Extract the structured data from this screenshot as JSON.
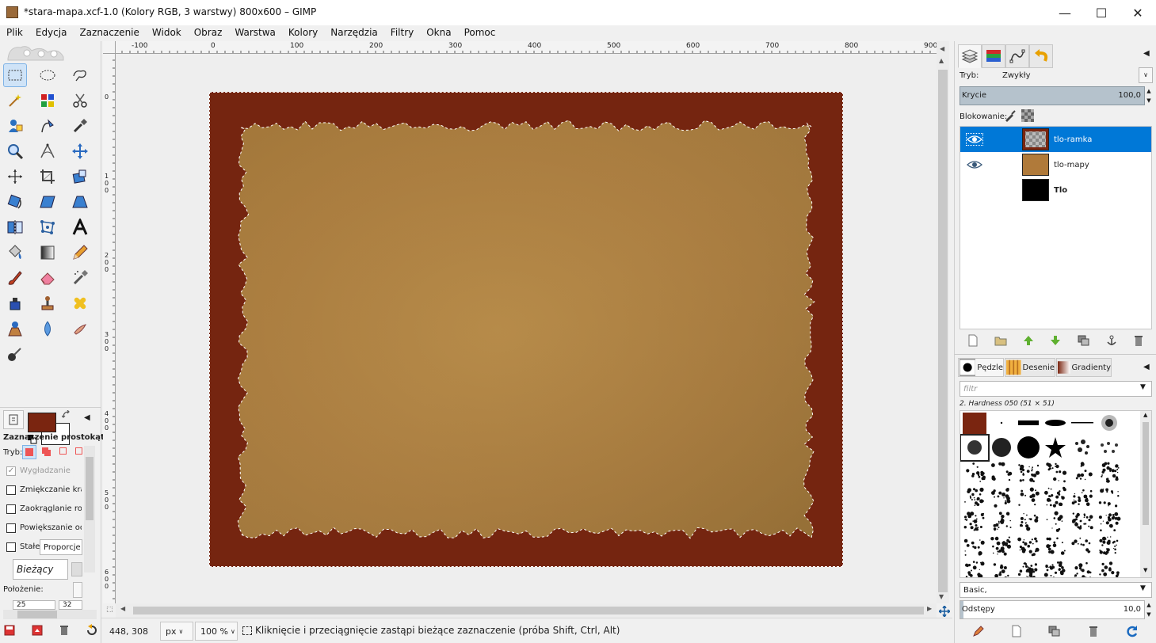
{
  "window": {
    "title": "*stara-mapa.xcf-1.0 (Kolory RGB, 3 warstwy) 800x600 – GIMP",
    "minimize": "—",
    "maximize": "☐",
    "close": "✕"
  },
  "menu": [
    "Plik",
    "Edycja",
    "Zaznaczenie",
    "Widok",
    "Obraz",
    "Warstwa",
    "Kolory",
    "Narzędzia",
    "Filtry",
    "Okna",
    "Pomoc"
  ],
  "toolbox": {
    "tools": [
      "rect-select",
      "ellipse-select",
      "free-select",
      "fuzzy-select",
      "select-by-color",
      "scissors-select",
      "foreground-select",
      "paths",
      "color-picker",
      "zoom",
      "measure",
      "move",
      "align",
      "crop",
      "unified-transform",
      "rotate",
      "shear",
      "perspective",
      "flip",
      "cage-transform",
      "text",
      "bucket-fill",
      "blend",
      "pencil",
      "paintbrush",
      "eraser",
      "airbrush",
      "ink",
      "clone",
      "heal",
      "perspective-clone",
      "blur",
      "smudge",
      "dodge-burn"
    ],
    "fg_color": "#7a2510",
    "bg_color": "#ffffff"
  },
  "tool_options": {
    "title": "Zaznaczenie prostokątne",
    "mode_label": "Tryb:",
    "antialias": "Wygładzanie",
    "feather": "Zmiękczanie kraw",
    "round_corners": "Zaokrąglanie rogó",
    "expand_center": "Powiększanie od ś",
    "fixed_label": "Stałe:",
    "fixed_value": "Proporcje",
    "current_value": "Bieżący",
    "position_label": "Położenie:",
    "pos_x": "25",
    "pos_y": "32"
  },
  "rulers": {
    "top_labels": [
      "-100",
      "0",
      "100",
      "200",
      "300",
      "400",
      "500",
      "600",
      "700",
      "800",
      "900"
    ],
    "left_labels": [
      "0",
      "100",
      "200",
      "300",
      "400",
      "500",
      "600"
    ]
  },
  "status": {
    "coords": "448, 308",
    "unit": "px",
    "zoom": "100 %",
    "message": "Kliknięcie i przeciągnięcie zastąpi bieżące zaznaczenie (próba Shift, Ctrl, Alt)"
  },
  "layers_dock": {
    "mode_label": "Tryb:",
    "mode_value": "Zwykły",
    "opacity_label": "Krycie",
    "opacity_value": "100,0",
    "lock_label": "Blokowanie:",
    "layers": [
      {
        "name": "tlo-ramka",
        "visible": true,
        "selected": true,
        "bold": false,
        "thumb": "checker"
      },
      {
        "name": "tlo-mapy",
        "visible": true,
        "selected": false,
        "bold": false,
        "thumb": "#b07a3a"
      },
      {
        "name": "Tlo",
        "visible": false,
        "selected": false,
        "bold": true,
        "thumb": "#000000"
      }
    ]
  },
  "brushes_dock": {
    "tabs": [
      "Pędzle",
      "Desenie",
      "Gradienty"
    ],
    "filter_placeholder": "filtr",
    "current_brush": "2. Hardness 050 (51 × 51)",
    "tag_value": "Basic,",
    "spacing_label": "Odstępy",
    "spacing_value": "10,0"
  }
}
